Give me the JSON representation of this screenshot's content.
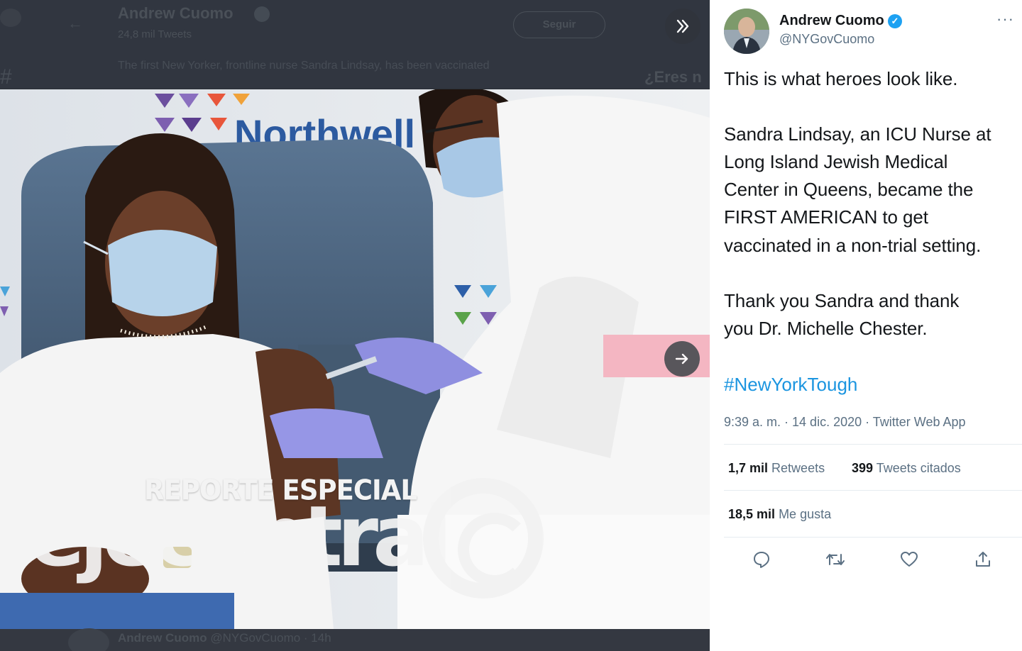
{
  "background": {
    "author_name": "Andrew Cuomo",
    "sub_line": "24,8 mil Tweets",
    "follow_label": "Seguir",
    "tweet_preview": "The first New Yorker, frontline nurse Sandra Lindsay, has been vaccinated",
    "side_text": "¿Eres n",
    "bottom_author": "Andrew Cuomo",
    "bottom_handle": "@NYGovCuomo · 14h"
  },
  "media": {
    "collapse_icon": "chevron-double-right-icon",
    "next_icon": "arrow-right-icon",
    "wall_logo_text": "Northwell",
    "watermark_top": "REPORTE ESPECIAL",
    "watermark_brand": "ejecentral"
  },
  "tweet": {
    "author_name": "Andrew Cuomo",
    "author_handle": "@NYGovCuomo",
    "more_icon": "more-horizontal-icon",
    "lines": [
      "This is what heroes look like.",
      "Sandra Lindsay, an ICU Nurse at",
      "Long Island Jewish Medical",
      "Center in Queens, became the",
      "FIRST AMERICAN to get",
      "vaccinated in a non-trial setting.",
      "Thank you Sandra and thank",
      "you Dr. Michelle Chester."
    ],
    "hashtag": "#NewYorkTough",
    "meta": "9:39 a. m. · 14 dic. 2020 · Twitter Web App",
    "stats": {
      "retweets_count": "1,7 mil",
      "retweets_label": "Retweets",
      "quotes_count": "399",
      "quotes_label": "Tweets citados",
      "likes_count": "18,5 mil",
      "likes_label": "Me gusta"
    },
    "actions": [
      "reply-icon",
      "retweet-icon",
      "like-icon",
      "share-icon"
    ]
  },
  "colors": {
    "link": "#1b95e0",
    "verified": "#1da1f2",
    "text": "#14171a",
    "secondary": "#5b7083",
    "backdrop": "#2a2f36"
  }
}
